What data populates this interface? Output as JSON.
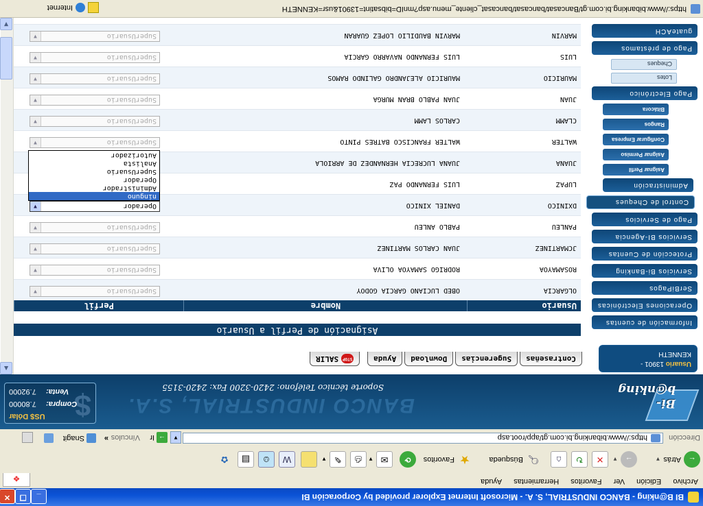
{
  "window": {
    "title": "BI B@nking - BANCO INDUSTRIAL, S. A. - Microsoft Internet Explorer provided by Corporación BI"
  },
  "menubar": {
    "items": [
      "Archivo",
      "Edición",
      "Ver",
      "Favoritos",
      "Herramientas",
      "Ayuda"
    ]
  },
  "toolbar": {
    "back": "Atrás",
    "search": "Búsqueda",
    "favorites": "Favoritos"
  },
  "addressbar": {
    "label": "Dirección",
    "url": "https://www.bibanking.bi.com.gt/app/root.asp",
    "go": "Ir",
    "links": "Vínculos",
    "snagit": "Snagit"
  },
  "header": {
    "logo": "Bi-b@nking",
    "bank_name": "BANCO INDUSTRIAL, S.A.",
    "support": "Soporte técnico Teléfono: 2420-3200 Fax: 2420-3155",
    "rates": {
      "title": "US$ Dólar",
      "buy_label": "Compra:",
      "buy": "7.80000",
      "sell_label": "Venta:",
      "sell": "7.92000"
    }
  },
  "sidebar": {
    "user_label": "Usuario",
    "user_id": "13901 -",
    "user_name": "KENNETH",
    "menu": [
      "Información de cuentas",
      "Operaciones Electrónicas",
      "SerBiPagos",
      "Servicios Bi-Banking",
      "Protección de Cuentas",
      "Servicios BI-Agencia",
      "Pago de Servicios",
      "Control de Cheques",
      "Administración",
      "Asignar Perfil",
      "Asignar Permiso",
      "Configurar Empresa",
      "Rangos",
      "Bitácora",
      "Pago Electrónico",
      "Lotes",
      "Cheques",
      "Pago de préstamos",
      "guateACH"
    ]
  },
  "tabs": [
    "Contraseñas",
    "Sugerencias",
    "Download",
    "Ayuda",
    "SALIR"
  ],
  "section_title": "Asignación de Perfil a Usuario",
  "table": {
    "headers": [
      "Usuario",
      "Nombre",
      "Perfil"
    ],
    "rows": [
      {
        "user": "OLGARCIA",
        "name": "OBED LUCIANO GARCIA GODOY",
        "perfil": "SuperUsuario"
      },
      {
        "user": "ROSAMAYOA",
        "name": "RODRIGO SAMAYOA OLIVA",
        "perfil": "SuperUsuario"
      },
      {
        "user": "JCMARTINEZ",
        "name": "JUAN CARLOS MARTINEZ",
        "perfil": "SuperUsuario"
      },
      {
        "user": "PANLEU",
        "name": "PABLO ANLEU",
        "perfil": "SuperUsuario"
      },
      {
        "user": "DXINICO",
        "name": "DANIEL XINICO",
        "perfil": "Operador"
      },
      {
        "user": "LUPAZ",
        "name": "LUIS FERNANDO PAZ",
        "perfil": ""
      },
      {
        "user": "JUANA",
        "name": "JUANA LUCRECIA HERNANDEZ DE ARRIOLA",
        "perfil": ""
      },
      {
        "user": "WALTER",
        "name": "WALTER FRANCISCO BATRES PINTO",
        "perfil": "SuperUsuario"
      },
      {
        "user": "CLAMM",
        "name": "CARLOS LAMM",
        "perfil": "SuperUsuario"
      },
      {
        "user": "JUAN",
        "name": "JUAN PABLO BRAN MURGA",
        "perfil": "SuperUsuario"
      },
      {
        "user": "MAURICIO",
        "name": "MAURICIO ALEJANDRO GALINDO RAMOS",
        "perfil": "SuperUsuario"
      },
      {
        "user": "LUIS",
        "name": "LUIS FERNANDO NAVARRO GARCIA",
        "perfil": "SuperUsuario"
      },
      {
        "user": "MARVIN",
        "name": "MARVIN BAUDILIO LOPEZ GUARAN",
        "perfil": "SuperUsuario"
      }
    ],
    "dropdown_options": [
      "ninguno",
      "Administrador",
      "Operador",
      "SuperUsuario",
      "Analista",
      "Autorizador"
    ]
  },
  "statusbar": {
    "url": "https://www.bibanking.bi.com.gt/Bancasat/bancasat/bancasat_cliente_menu.asp?mnID=bibsatint=13901&usr=KENNETH",
    "zone": "Internet"
  }
}
